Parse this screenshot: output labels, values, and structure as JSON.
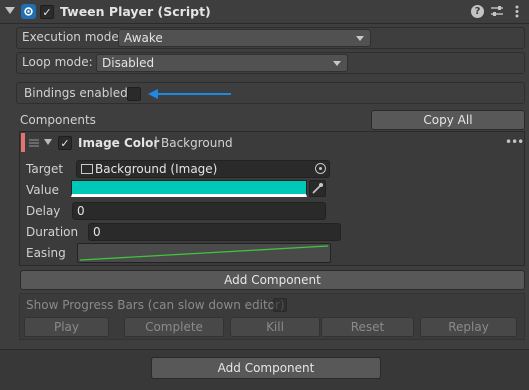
{
  "header": {
    "title": "Tween Player (Script)",
    "enabled": true,
    "icons": [
      "help-icon",
      "presets-icon",
      "more-icon"
    ]
  },
  "execution": {
    "label": "Execution mode:",
    "value": "Awake"
  },
  "loop": {
    "label": "Loop mode:",
    "value": "Disabled"
  },
  "bindings": {
    "label": "Bindings enabled",
    "checked": false
  },
  "components": {
    "label": "Components",
    "copy_all": "Copy All",
    "item": {
      "enabled": true,
      "name": "Image Color",
      "separator": "|",
      "target_name": "Background",
      "target_label": "Target",
      "target_value": "Background (Image)",
      "value_label": "Value",
      "value_color": "#00c8b8",
      "delay_label": "Delay",
      "delay_value": "0",
      "duration_label": "Duration",
      "duration_value": "0",
      "easing_label": "Easing"
    },
    "add_component": "Add Component"
  },
  "progress": {
    "label": "Show Progress Bars (can slow down editor)",
    "checked": false,
    "buttons": [
      "Play",
      "Complete",
      "Kill",
      "Reset",
      "Replay"
    ]
  },
  "bottom_add_component": "Add Component"
}
